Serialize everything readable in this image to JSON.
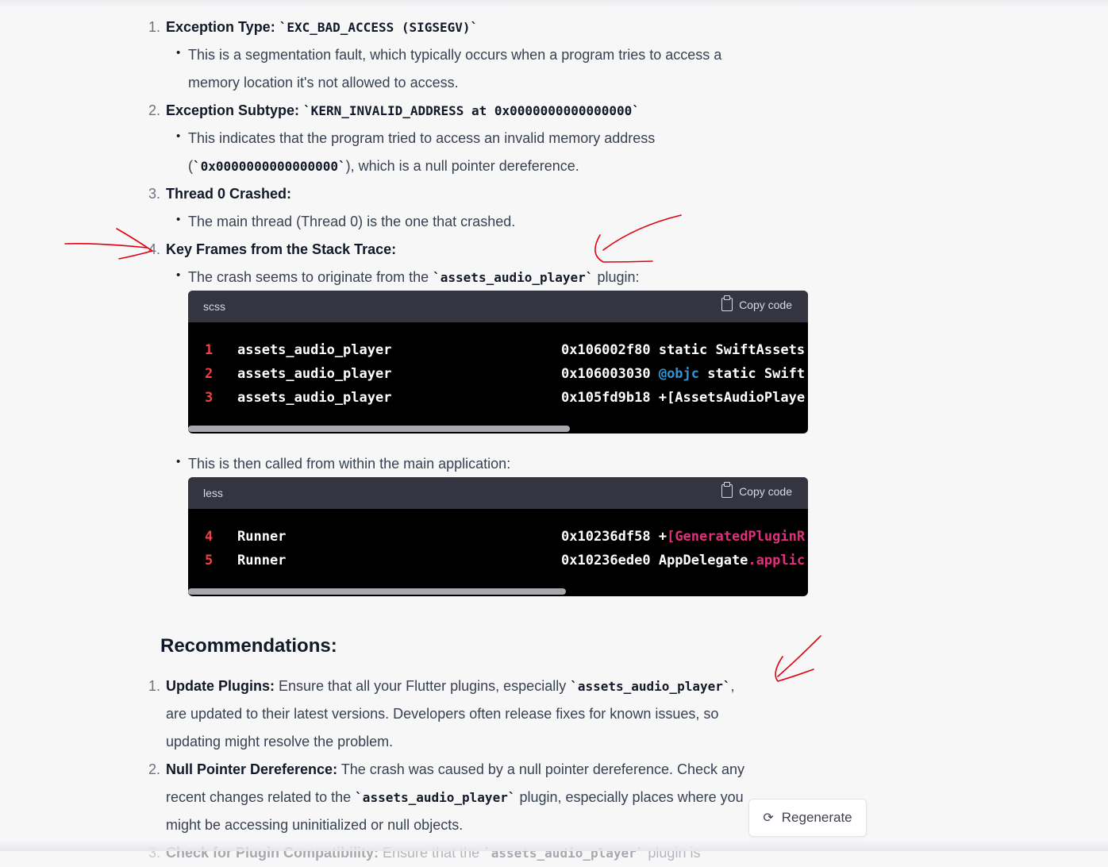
{
  "list1": [
    {
      "num": "1.",
      "title": "Exception Type:",
      "code": "`EXC_BAD_ACCESS (SIGSEGV)`",
      "bullet_line1": "This is a segmentation fault, which typically occurs when a program tries to access a",
      "bullet_line2": "memory location it's not allowed to access."
    },
    {
      "num": "2.",
      "title": "Exception Subtype:",
      "code": "`KERN_INVALID_ADDRESS at 0x0000000000000000`",
      "bullet_line1": "This indicates that the program tried to access an invalid memory address",
      "bullet_line2_open": "(",
      "bullet_line2_code": "`0x0000000000000000`",
      "bullet_line2_rest": "), which is a null pointer dereference."
    },
    {
      "num": "3.",
      "title": "Thread 0 Crashed:",
      "bullet_line1": "The main thread (Thread 0) is the one that crashed."
    },
    {
      "num": "4.",
      "title": "Key Frames from the Stack Trace:",
      "bullet1_pre": "The crash seems to originate from the ",
      "bullet1_code": "`assets_audio_player`",
      "bullet1_post": " plugin:",
      "bullet2": "This is then called from within the main application:"
    }
  ],
  "codeblock1": {
    "lang": "scss",
    "copy_label": "Copy code",
    "lines": [
      {
        "ln": "1",
        "fn": "assets_audio_player",
        "addr": "0x106002f80",
        "rest": " static SwiftAssets"
      },
      {
        "ln": "2",
        "fn": "assets_audio_player",
        "addr": "0x106003030",
        "kw": " @objc",
        "rest": " static Swift"
      },
      {
        "ln": "3",
        "fn": "assets_audio_player",
        "addr": "0x105fd9b18",
        "rest": " +[AssetsAudioPlaye"
      }
    ]
  },
  "codeblock2": {
    "lang": "less",
    "copy_label": "Copy code",
    "lines": [
      {
        "ln": "4",
        "fn": "Runner",
        "addr": "0x10236df58",
        "rest": " +",
        "kw": "[GeneratedPluginR"
      },
      {
        "ln": "5",
        "fn": "Runner",
        "addr": "0x10236ede0",
        "rest": " AppDelegate",
        "kw": ".applic"
      }
    ]
  },
  "recommendations": {
    "heading": "Recommendations:",
    "items": [
      {
        "num": "1.",
        "title": "Update Plugins:",
        "line1_text": " Ensure that all your Flutter plugins, especially ",
        "line1_code": "`assets_audio_player`",
        "line1_post": ",",
        "line2": "are updated to their latest versions. Developers often release fixes for known issues, so",
        "line3": "updating might resolve the problem."
      },
      {
        "num": "2.",
        "title": "Null Pointer Dereference:",
        "line1_text": " The crash was caused by a null pointer dereference. Check any",
        "line2_pre": "recent changes related to the ",
        "line2_code": "`assets_audio_player`",
        "line2_post": " plugin, especially places where you",
        "line3": "might be accessing uninitialized or null objects."
      },
      {
        "num": "3.",
        "title": "Check for Plugin Compatibility:",
        "line1_text": " Ensure that the ",
        "line1_code": "`assets_audio_player`",
        "line1_post": " plugin is"
      }
    ]
  },
  "regenerate_label": "Regenerate",
  "colors": {
    "background": "#f7f7f8",
    "code_bg": "#000000",
    "code_header": "#343541",
    "annotation": "#e0000f",
    "line_number": "#ef4146",
    "keyword_blue": "#2e95d3",
    "keyword_red": "#df3079"
  }
}
